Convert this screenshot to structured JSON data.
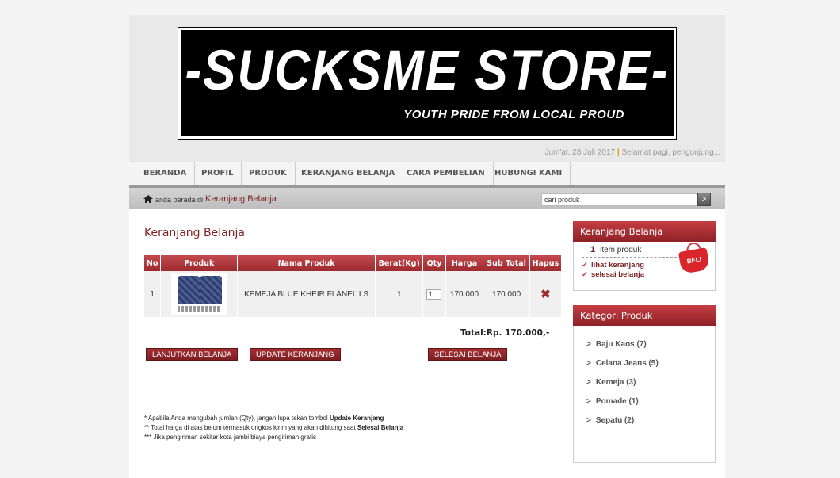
{
  "header": {
    "logo_title": "-SUCKSME STORE-",
    "logo_subtitle": "YOUTH PRIDE FROM LOCAL PROUD",
    "date": "Jum'at, 28 Juli 2017",
    "separator": "|",
    "greeting": "Selamat pagi, pengunjung..."
  },
  "nav": {
    "items": [
      "BERANDA",
      "PROFIL",
      "PRODUK",
      "KERANJANG BELANJA",
      "CARA PEMBELIAN",
      "HUBUNGI KAMI"
    ]
  },
  "breadcrumb": {
    "prefix": "anda berada di:",
    "current": "Keranjang Belanja"
  },
  "search": {
    "value": "cari produk",
    "button": ">"
  },
  "cart": {
    "title": "Keranjang Belanja",
    "columns": [
      "No",
      "Produk",
      "Nama Produk",
      "Berat(Kg)",
      "Qty",
      "Harga",
      "Sub Total",
      "Hapus"
    ],
    "rows": [
      {
        "no": "1",
        "name": "KEMEJA BLUE KHEIR FLANEL LS",
        "weight": "1",
        "qty": "1",
        "price": "170.000",
        "subtotal": "170.000",
        "delete": "✖"
      }
    ],
    "total": "Total:Rp. 170.000,-",
    "buttons": {
      "continue": "LANJUTKAN BELANJA",
      "update": "UPDATE KERANJANG",
      "finish": "SELESAI BELANJA"
    },
    "notes": [
      {
        "text": "* Apabila Anda mengubah jumlah (Qty), jangan lupa tekan tombol ",
        "bold": "Update Keranjang"
      },
      {
        "text": "** Total harga di atas belum termasuk ongkos kirim yang akan dihitung saat ",
        "bold": "Selesai Belanja"
      },
      {
        "text": "*** Jika pengiriman sekitar kota jambi biaya pengiriman gratis",
        "bold": ""
      }
    ]
  },
  "sidebar": {
    "cart_title": "Keranjang Belanja",
    "cart_count": "1",
    "cart_count_label": "item produk",
    "view_cart": "lihat keranjang",
    "finish_shopping": "selesai belanja",
    "bag_label": "BELI",
    "category_title": "Kategori Produk",
    "categories": [
      "Baju Kaos (7)",
      "Celana Jeans (5)",
      "Kemeja (3)",
      "Pomade (1)",
      "Sepatu (2)"
    ]
  },
  "colors": {
    "accent": "#7d1f22",
    "header_red": "#b03439"
  }
}
